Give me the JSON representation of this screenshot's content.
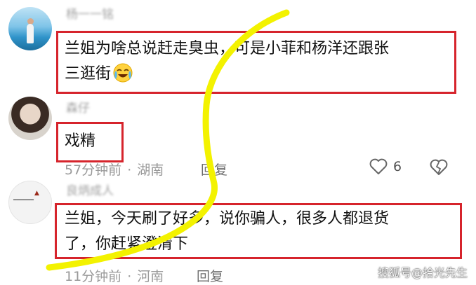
{
  "comments": [
    {
      "username": "杨一一铭",
      "text_line1": "兰姐为啥总说赶走臭虫，可是小菲和杨洋还跟张",
      "text_line2": "三逛街",
      "emoji": "crying-laughing-emoji"
    },
    {
      "username": "森仔",
      "text": "戏精",
      "time": "57分钟前",
      "location": "湖南",
      "reply_label": "回复",
      "likes": "6"
    },
    {
      "username": "良炳成人",
      "text_line1": "兰姐，今天刷了好多，说你骗人，很多人都退货",
      "text_line2": "了，你赶紧澄清下",
      "time": "11分钟前",
      "location": "河南",
      "reply_label": "回复"
    }
  ],
  "separator": "·",
  "watermark": "搜狐号@拾光先生",
  "colors": {
    "highlight_box": "#d6242c",
    "annotation_stroke": "#f3f200",
    "meta_text": "#9a9a9a"
  }
}
